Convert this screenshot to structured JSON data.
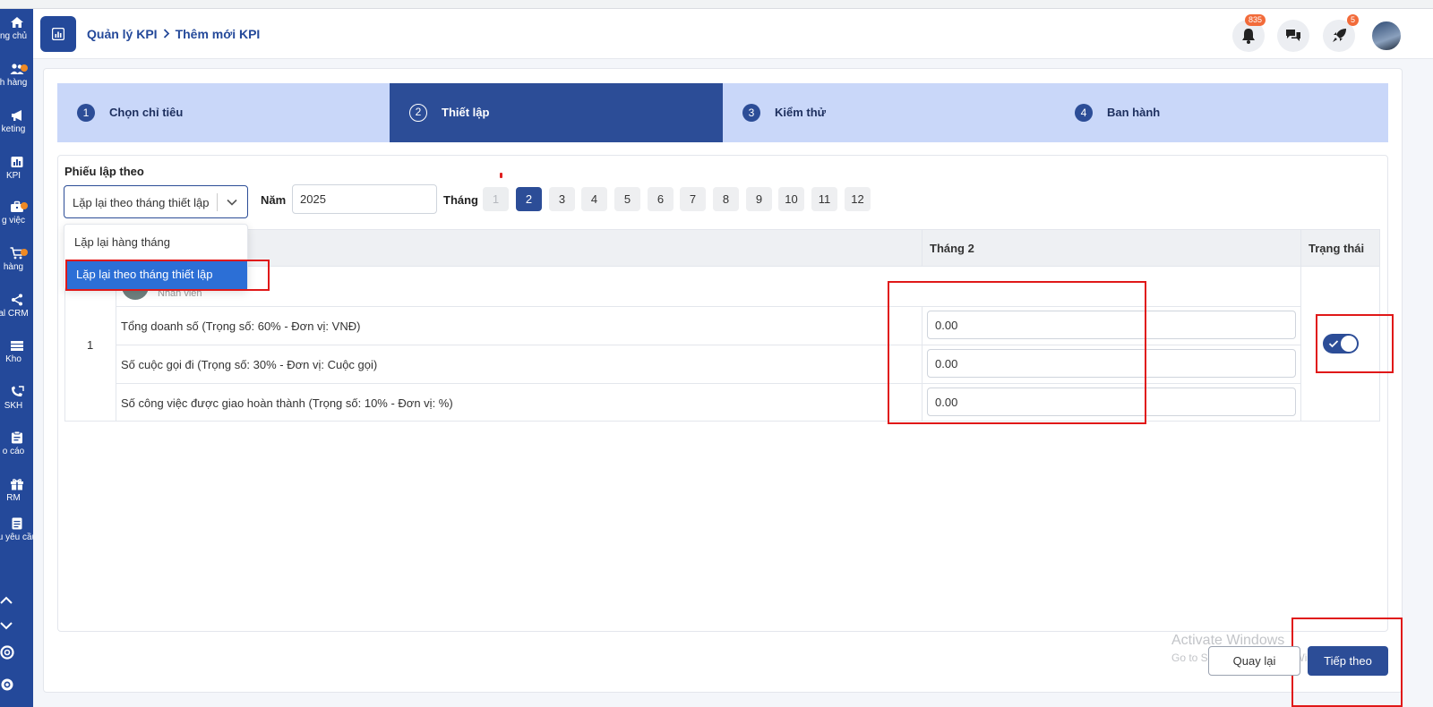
{
  "sidebar": {
    "items": [
      {
        "label": "ng chủ",
        "icon": "home-icon"
      },
      {
        "label": "h hàng",
        "icon": "customers-icon"
      },
      {
        "label": "keting",
        "icon": "marketing-icon"
      },
      {
        "label": "KPI",
        "icon": "chart-icon"
      },
      {
        "label": "g việc",
        "icon": "briefcase-icon"
      },
      {
        "label": "hàng",
        "icon": "cart-icon"
      },
      {
        "label": "al CRM",
        "icon": "share-icon"
      },
      {
        "label": "Kho",
        "icon": "warehouse-icon"
      },
      {
        "label": "SKH",
        "icon": "phone-icon"
      },
      {
        "label": "o cáo",
        "icon": "report-icon"
      },
      {
        "label": "RM",
        "icon": "gift-icon"
      },
      {
        "label": "iếu yêu cầu",
        "icon": "document-icon"
      }
    ]
  },
  "header": {
    "breadcrumb_root": "Quản lý KPI",
    "breadcrumb_current": "Thêm mới KPI",
    "notification_count": "835",
    "rocket_count": "5"
  },
  "steps": [
    {
      "num": "1",
      "label": "Chọn chỉ tiêu"
    },
    {
      "num": "2",
      "label": "Thiết lập"
    },
    {
      "num": "3",
      "label": "Kiểm thử"
    },
    {
      "num": "4",
      "label": "Ban hành"
    }
  ],
  "form": {
    "phieu_label": "Phiếu lập theo",
    "select_value": "Lặp lại theo tháng thiết lập",
    "year_label": "Năm",
    "year_value": "2025",
    "month_label": "Tháng",
    "months": [
      "1",
      "2",
      "3",
      "4",
      "5",
      "6",
      "7",
      "8",
      "9",
      "10",
      "11",
      "12"
    ],
    "selected_month": "2"
  },
  "dropdown": {
    "options": [
      "Lặp lại hàng tháng",
      "Lặp lại theo tháng thiết lập"
    ]
  },
  "table": {
    "col_month": "Tháng 2",
    "col_status": "Trạng thái",
    "row_index": "1",
    "employee_role": "Nhân viên",
    "kpis": [
      {
        "label": "Tổng doanh số (Trọng số: 60% - Đơn vị: VNĐ)",
        "value": "0.00"
      },
      {
        "label": "Số cuộc gọi đi (Trọng số: 30% - Đơn vị: Cuộc gọi)",
        "value": "0.00"
      },
      {
        "label": "Số công việc được giao hoàn thành (Trọng số: 10% - Đơn vị: %)",
        "value": "0.00"
      }
    ]
  },
  "footer": {
    "back_label": "Quay lại",
    "next_label": "Tiếp theo",
    "watermark_title": "Activate Windows",
    "watermark_sub": "Go to Settings to activate Windows."
  },
  "colors": {
    "sidebar": "#24499a",
    "primary": "#2c4d97",
    "step_inactive": "#c9d7f9",
    "highlight": "#2c6fd6",
    "annotation": "#e01818"
  }
}
